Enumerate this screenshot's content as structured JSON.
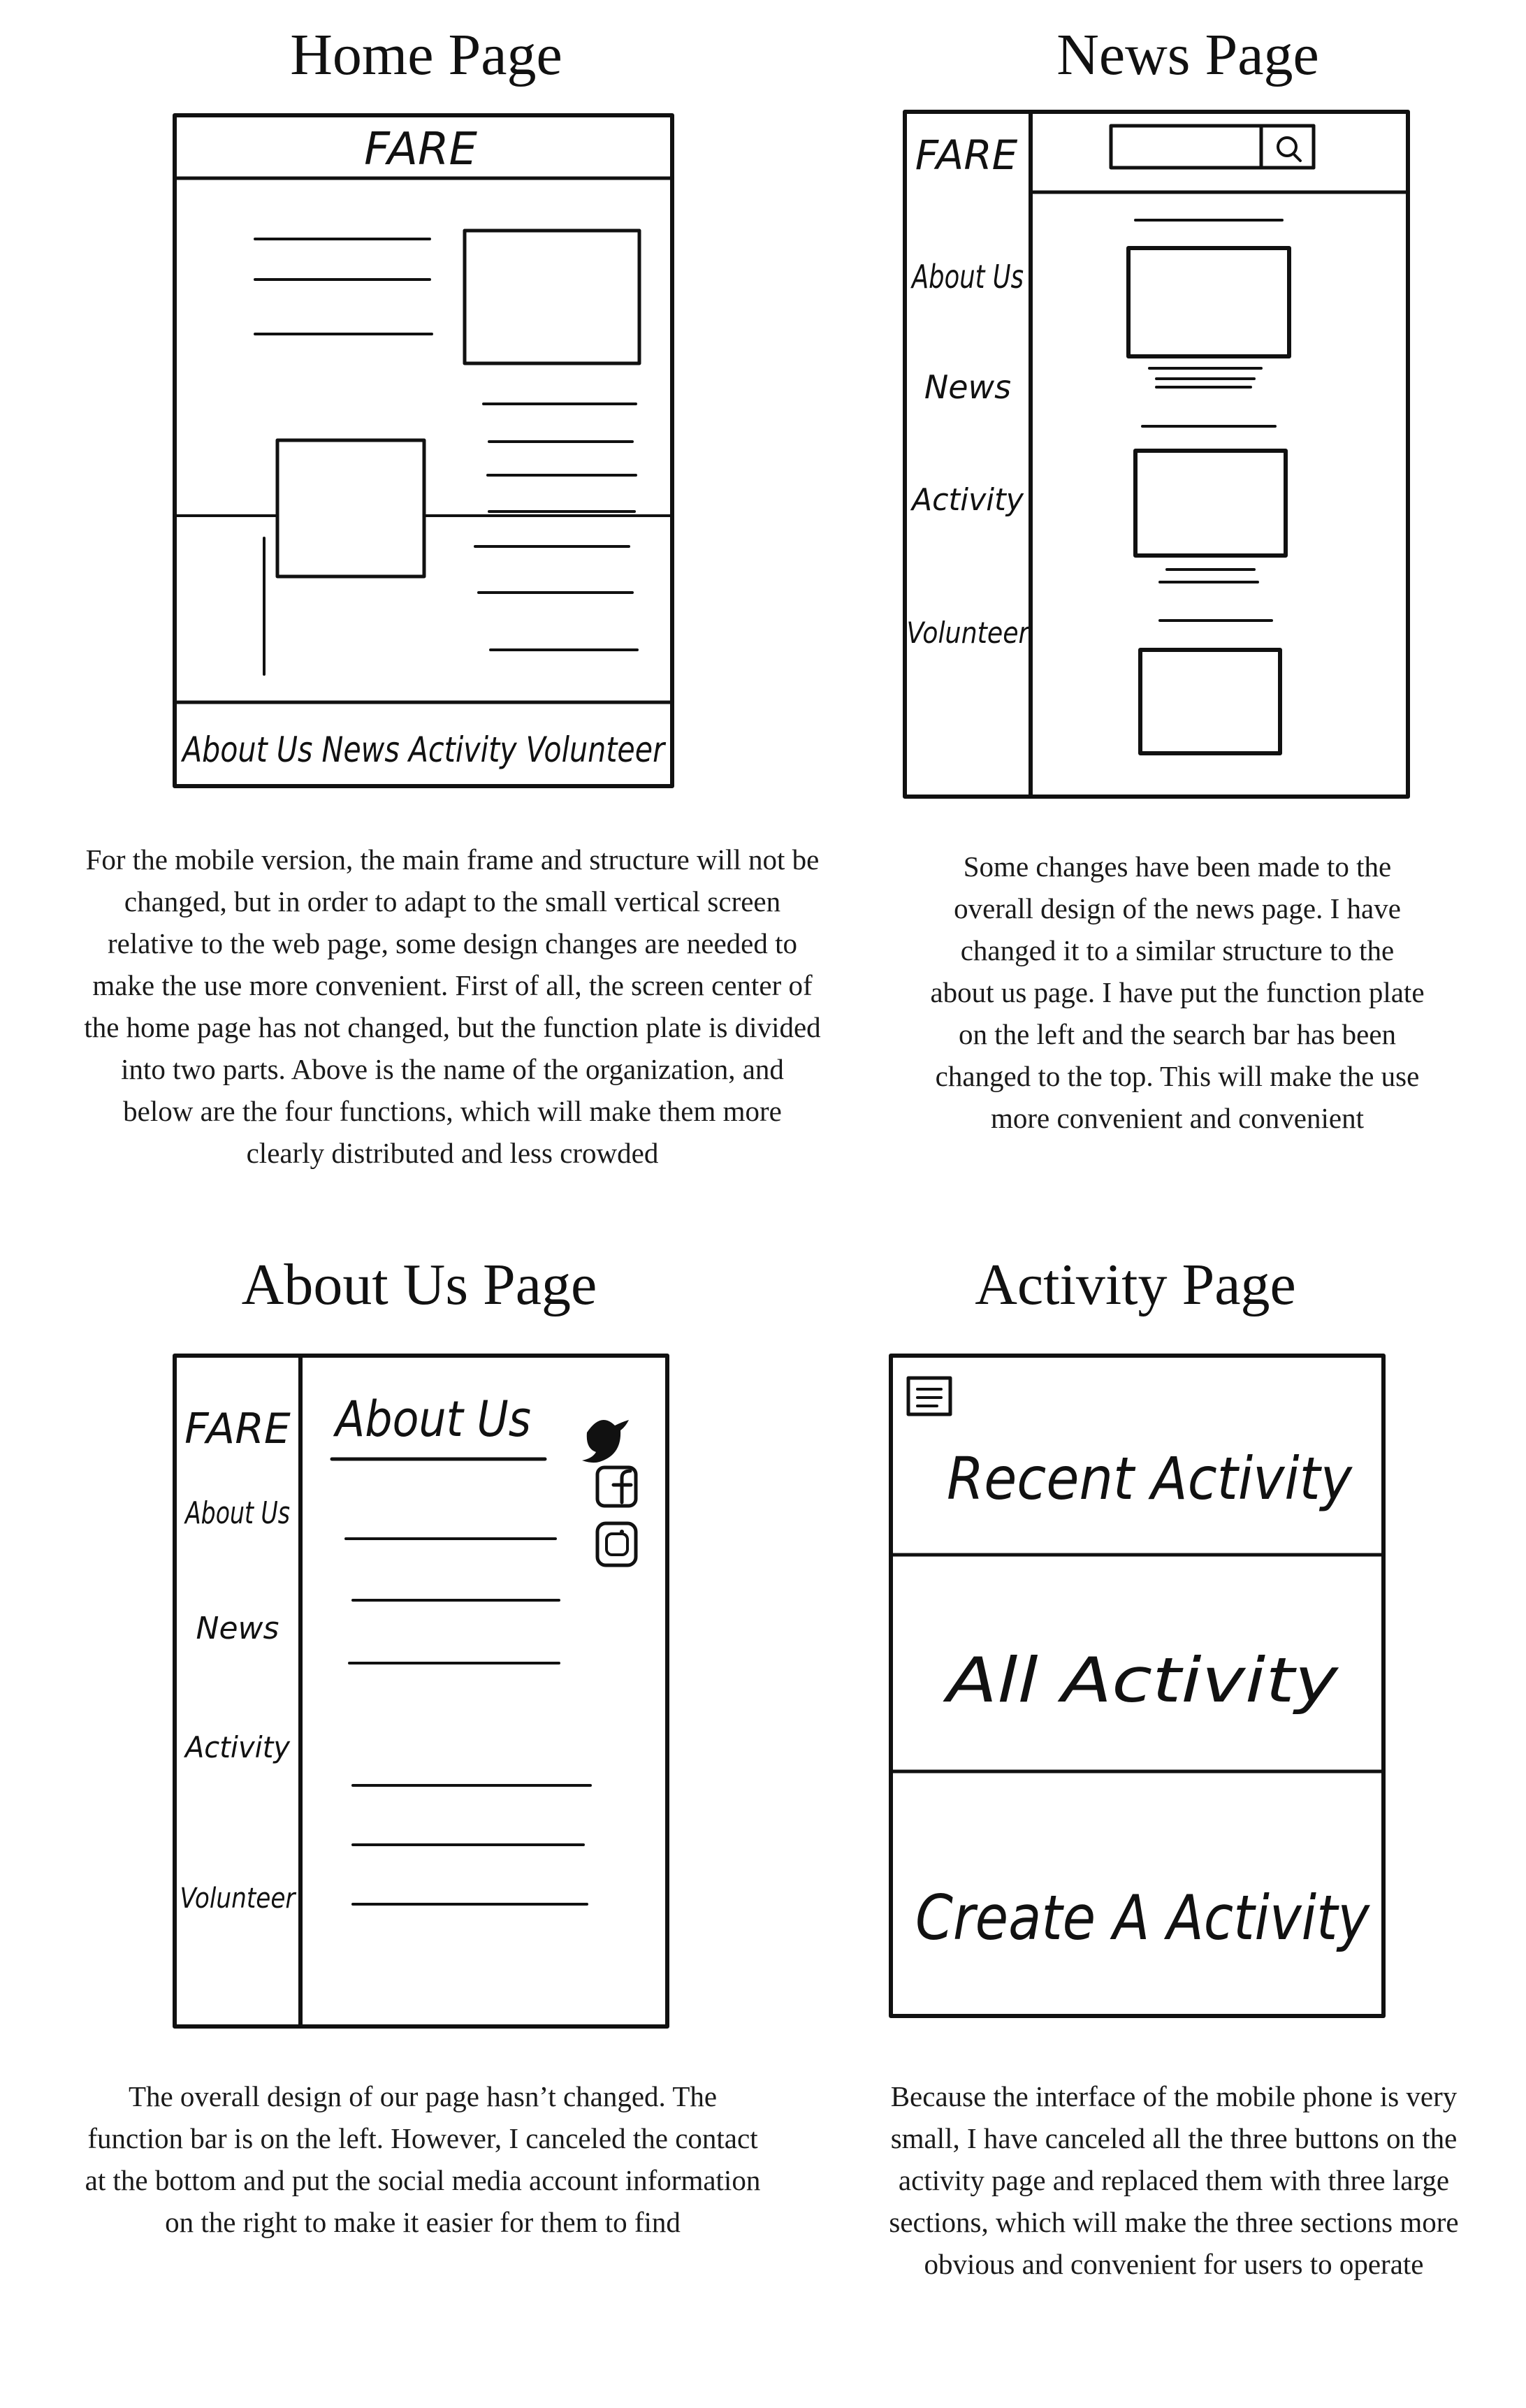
{
  "sections": {
    "home": {
      "title": "Home Page",
      "brand": "FARE",
      "nav": "About Us News Activity Volunteer",
      "description": "For the mobile version, the main frame and structure will not be changed, but in order to adapt to the small vertical screen relative to the web page, some design changes are needed to make the use more convenient. First of all, the screen center of the home page has not changed, but the function plate is divided into two parts. Above is the name of the organization, and below are the four functions, which will make them more clearly distributed and less crowded"
    },
    "news": {
      "title": "News Page",
      "brand": "FARE",
      "nav": [
        "About Us",
        "News",
        "Activity",
        "Volunteer"
      ],
      "search_icon": "search-icon",
      "description": "Some changes have been made to the overall design of the news page. I have changed it to a similar structure to the about us page. I have put the function plate on the left and the search bar has been changed to the top. This will make the use more convenient and convenient"
    },
    "about": {
      "title": "About Us Page",
      "brand": "FARE",
      "heading": "About Us",
      "nav": [
        "About Us",
        "News",
        "Activity",
        "Volunteer"
      ],
      "social_icons": [
        "twitter-icon",
        "facebook-icon",
        "instagram-icon"
      ],
      "description": "The overall design of our page hasn’t changed. The function bar is on the left. However, I canceled the contact at the bottom and put the social media account information on the right to make it easier for them to find"
    },
    "activity": {
      "title": "Activity Page",
      "menu_icon": "menu-icon",
      "rows": [
        "Recent Activity",
        "All Activity",
        "Create A Activity"
      ],
      "description": "Because the interface of the mobile phone is very small, I have canceled all the three buttons on the activity page and replaced them with three large sections, which will make the three sections more obvious and convenient for users to operate"
    }
  }
}
